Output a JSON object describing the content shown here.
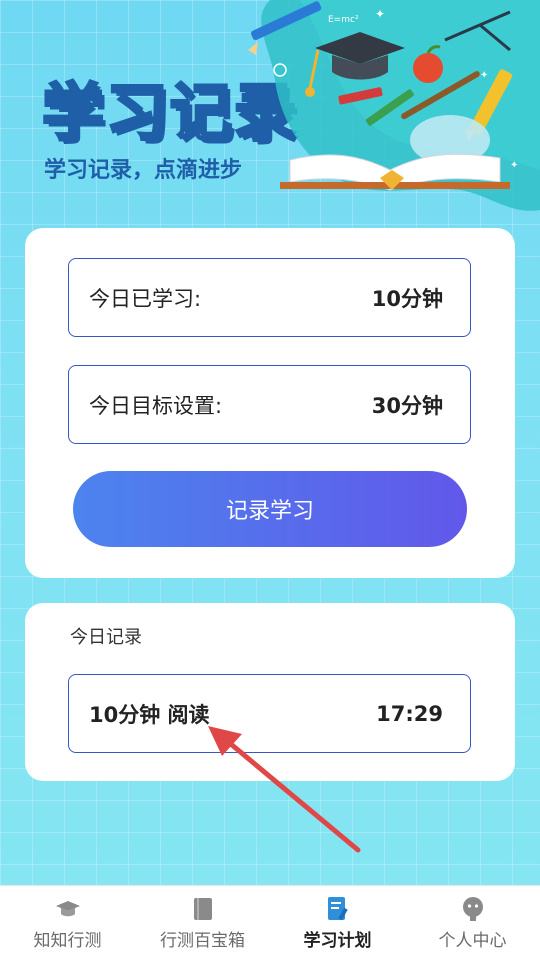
{
  "header": {
    "title": "学习记录",
    "subtitle": "学习记录，点滴进步"
  },
  "today_card": {
    "studied_label": "今日已学习:",
    "studied_value": "10分钟",
    "goal_label": "今日目标设置:",
    "goal_value": "30分钟",
    "record_button": "记录学习"
  },
  "log_card": {
    "section_title": "今日记录",
    "entries": [
      {
        "text": "10分钟 阅读",
        "time": "17:29"
      }
    ]
  },
  "tabbar": {
    "tabs": [
      {
        "label": "知知行测",
        "icon": "graduation-cap-icon"
      },
      {
        "label": "行测百宝箱",
        "icon": "book-icon"
      },
      {
        "label": "学习计划",
        "icon": "notepad-pen-icon",
        "active": true
      },
      {
        "label": "个人中心",
        "icon": "person-icon"
      }
    ]
  },
  "colors": {
    "accent_blue": "#1e5fa8",
    "button_start": "#4c84ee",
    "button_end": "#6158ea",
    "row_border": "#3a55c8",
    "active_tab_icon": "#2f8fd8",
    "arrow": "#e04848"
  }
}
